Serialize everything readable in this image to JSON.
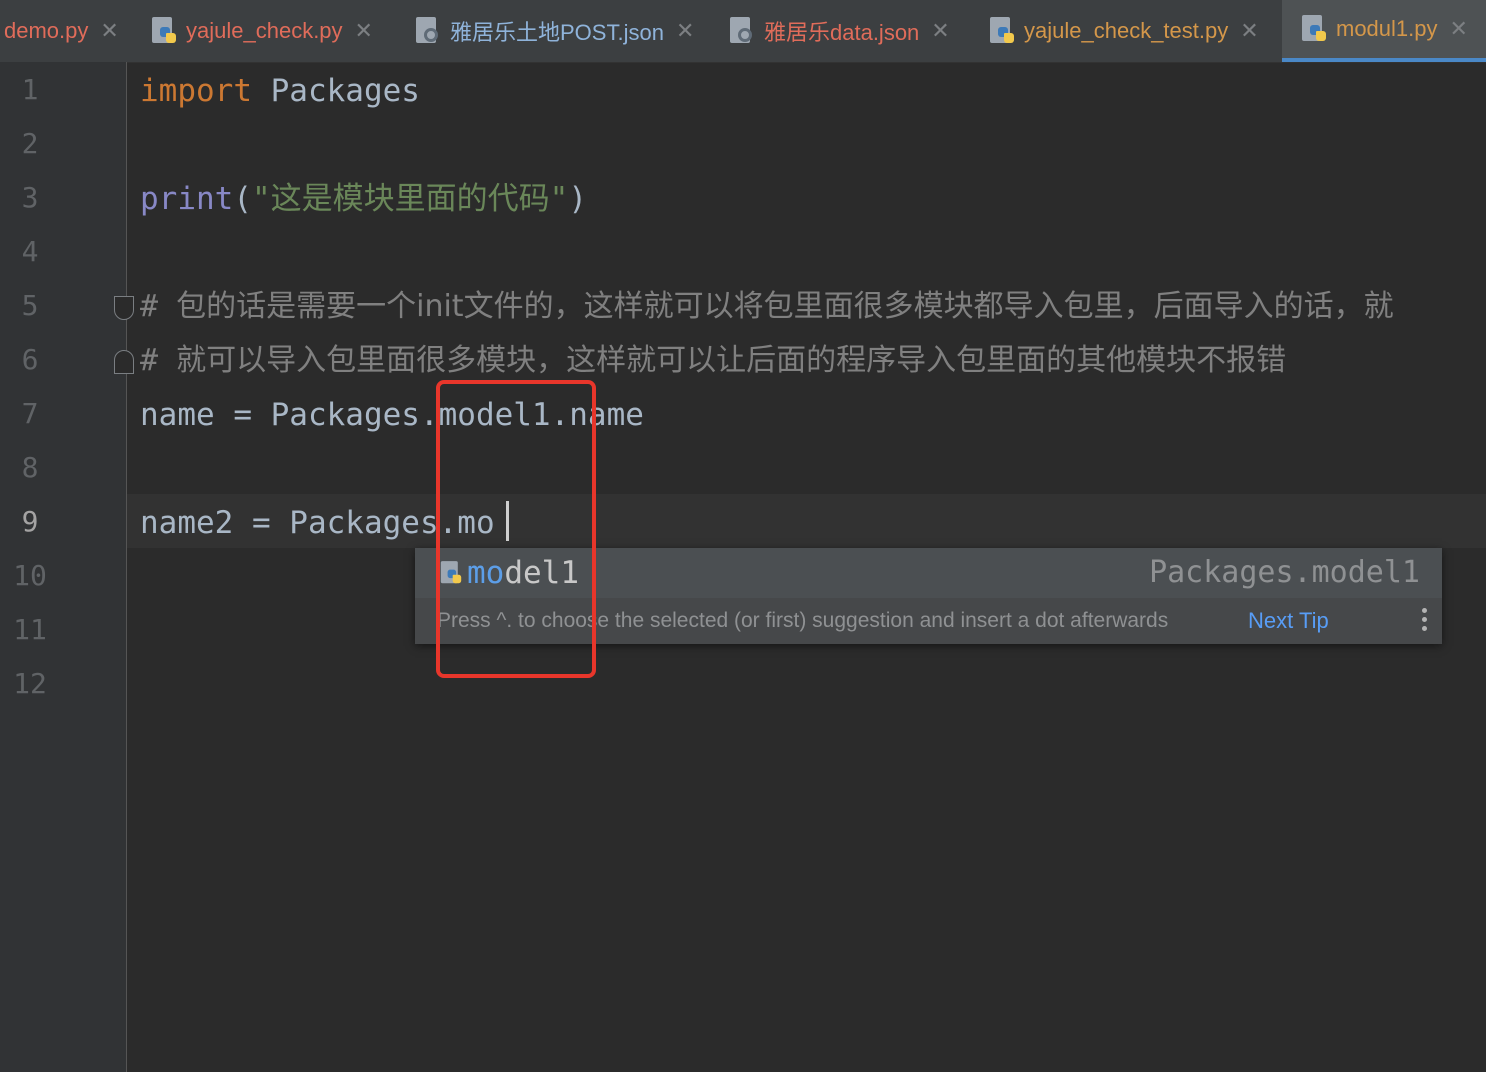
{
  "tabs": [
    {
      "label": "demo.py",
      "type": "py",
      "state": "err"
    },
    {
      "label": "yajule_check.py",
      "type": "py",
      "state": "err"
    },
    {
      "label": "雅居乐土地POST.json",
      "type": "json",
      "state": "blue"
    },
    {
      "label": "雅居乐data.json",
      "type": "json",
      "state": "err"
    },
    {
      "label": "yajule_check_test.py",
      "type": "py",
      "state": "ok"
    },
    {
      "label": "modul1.py",
      "type": "py",
      "state": "active"
    }
  ],
  "editor": {
    "line_numbers": [
      "1",
      "2",
      "3",
      "4",
      "5",
      "6",
      "7",
      "8",
      "9",
      "10",
      "11",
      "12"
    ],
    "current_line": "9",
    "lines": {
      "l1_kw": "import",
      "l1_rest": " Packages",
      "l3_func": "print",
      "l3_open": "(",
      "l3_str": "\"这是模块里面的代码\"",
      "l3_close": ")",
      "l5_hash": "# ",
      "l5_text": "包的话是需要一个init文件的，这样就可以将包里面很多模块都导入包里，后面导入的话，就",
      "l6_hash": "# ",
      "l6_text": "就可以导入包里面很多模块，这样就可以让后面的程序导入包里面的其他模块不报错",
      "l7": "name = Packages.model1.name",
      "l9": "name2 = Packages.mo"
    }
  },
  "completion": {
    "match": "mo",
    "rest": "del1",
    "qualifier": "Packages.model1",
    "hint": "Press ^. to choose the selected (or first) suggestion and insert a dot afterwards",
    "next_tip": "Next Tip"
  },
  "colors": {
    "accent": "#4a88c7",
    "annotation": "#e8362b",
    "keyword": "#cc7832",
    "string": "#6a8759"
  }
}
